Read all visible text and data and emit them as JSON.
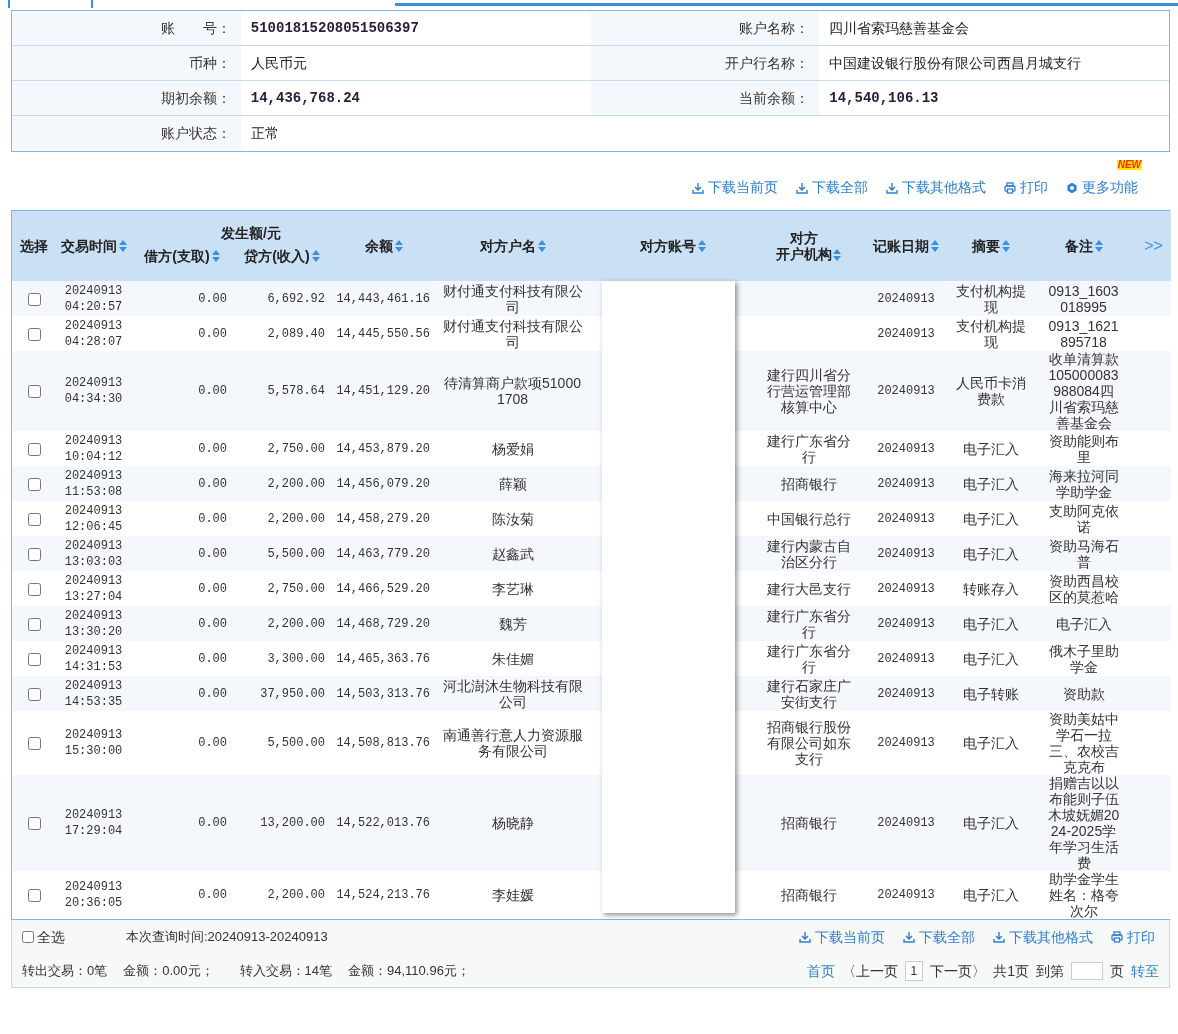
{
  "account_info": [
    {
      "label": "账　　号：",
      "value": "5100181520805150639​7",
      "kind": "amount"
    },
    {
      "label": "账户名称：",
      "value": "四川省索玛慈善基金会",
      "kind": "text"
    },
    {
      "label": "币种：",
      "value": "人民币元",
      "kind": "text"
    },
    {
      "label": "开户行名称：",
      "value": "中国建设银行股份有限公司西昌月城支行",
      "kind": "text"
    },
    {
      "label": "期初余额：",
      "value": "14,436,768.24",
      "kind": "amount"
    },
    {
      "label": "当前余额：",
      "value": "14,540,106.13",
      "kind": "amount"
    },
    {
      "label": "账户状态：",
      "value": "正常",
      "kind": "text"
    }
  ],
  "toolbar": {
    "new_badge": "NEW",
    "links": [
      {
        "kind": "download",
        "label": "下载当前页"
      },
      {
        "kind": "download",
        "label": "下载全部"
      },
      {
        "kind": "download",
        "label": "下载其他格式"
      },
      {
        "kind": "print",
        "label": "打印"
      },
      {
        "kind": "settings",
        "label": "更多功能"
      }
    ]
  },
  "table": {
    "group_header": "发生额/元",
    "more_columns": ">>",
    "columns": [
      {
        "label_lines": [
          "选择"
        ],
        "sortable": false
      },
      {
        "label_lines": [
          "交易时间"
        ],
        "sortable": true
      },
      {
        "label_lines": [
          "借方(支取)"
        ],
        "sortable": true,
        "in_group": true
      },
      {
        "label_lines": [
          "贷方(收入)"
        ],
        "sortable": true,
        "in_group": true
      },
      {
        "label_lines": [
          "余额"
        ],
        "sortable": true
      },
      {
        "label_lines": [
          "对方户名"
        ],
        "sortable": true
      },
      {
        "label_lines": [
          "对方账号"
        ],
        "sortable": true
      },
      {
        "label_lines": [
          "对方",
          "开户机构"
        ],
        "sortable": true
      },
      {
        "label_lines": [
          "记账日期"
        ],
        "sortable": true
      },
      {
        "label_lines": [
          "摘要"
        ],
        "sortable": true
      },
      {
        "label_lines": [
          "备注"
        ],
        "sortable": true
      }
    ],
    "rows": [
      {
        "checked": false,
        "date_part": "20240913",
        "time_part": "04:20:57",
        "debit": "0.00",
        "credit": "6,692.92",
        "balance": "14,443,461.16",
        "name": "财付通支付科技有限公司",
        "bank": "",
        "post_date": "20240913",
        "summary": "支付机构提现",
        "remark": "0913_1603018995"
      },
      {
        "checked": false,
        "date_part": "20240913",
        "time_part": "04:28:07",
        "debit": "0.00",
        "credit": "2,089.40",
        "balance": "14,445,550.56",
        "name": "财付通支付科技有限公司",
        "bank": "",
        "post_date": "20240913",
        "summary": "支付机构提现",
        "remark": "0913_1621895718"
      },
      {
        "checked": false,
        "date_part": "20240913",
        "time_part": "04:34:30",
        "debit": "0.00",
        "credit": "5,578.64",
        "balance": "14,451,129.20",
        "name": "待清算商户款项510001708",
        "bank": "建行四川省分行营运管理部核算中心",
        "post_date": "20240913",
        "summary": "人民币卡消费款",
        "remark": "收单清算款105000083988084四川省索玛慈善基金会"
      },
      {
        "checked": false,
        "date_part": "20240913",
        "time_part": "10:04:12",
        "debit": "0.00",
        "credit": "2,750.00",
        "balance": "14,453,879.20",
        "name": "杨爱娟",
        "bank": "建行广东省分行",
        "post_date": "20240913",
        "summary": "电子汇入",
        "remark": "资助能则布里"
      },
      {
        "checked": false,
        "date_part": "20240913",
        "time_part": "11:53:08",
        "debit": "0.00",
        "credit": "2,200.00",
        "balance": "14,456,079.20",
        "name": "薛颖",
        "bank": "招商银行",
        "post_date": "20240913",
        "summary": "电子汇入",
        "remark": "海来拉河同学助学金"
      },
      {
        "checked": false,
        "date_part": "20240913",
        "time_part": "12:06:45",
        "debit": "0.00",
        "credit": "2,200.00",
        "balance": "14,458,279.20",
        "name": "陈汝菊",
        "bank": "中国银行总行",
        "post_date": "20240913",
        "summary": "电子汇入",
        "remark": "支助阿克依诺"
      },
      {
        "checked": false,
        "date_part": "20240913",
        "time_part": "13:03:03",
        "debit": "0.00",
        "credit": "5,500.00",
        "balance": "14,463,779.20",
        "name": "赵鑫武",
        "bank": "建行内蒙古自治区分行",
        "post_date": "20240913",
        "summary": "电子汇入",
        "remark": "资助马海石普"
      },
      {
        "checked": false,
        "date_part": "20240913",
        "time_part": "13:27:04",
        "debit": "0.00",
        "credit": "2,750.00",
        "balance": "14,466,529.20",
        "name": "李艺琳",
        "bank": "建行大邑支行",
        "post_date": "20240913",
        "summary": "转账存入",
        "remark": "资助西昌校区的莫惹哈"
      },
      {
        "checked": false,
        "date_part": "20240913",
        "time_part": "13:30:20",
        "debit": "0.00",
        "credit": "2,200.00",
        "balance": "14,468,729.20",
        "name": "魏芳",
        "bank": "建行广东省分行",
        "post_date": "20240913",
        "summary": "电子汇入",
        "remark": "电子汇入"
      },
      {
        "checked": false,
        "date_part": "20240913",
        "time_part": "14:31:53",
        "debit": "0.00",
        "credit": "3,300.00",
        "balance": "14,465,363.76",
        "name": "朱佳媚",
        "bank": "建行广东省分行",
        "post_date": "20240913",
        "summary": "电子汇入",
        "remark": "俄木子里助学金"
      },
      {
        "checked": false,
        "date_part": "20240913",
        "time_part": "14:53:35",
        "debit": "0.00",
        "credit": "37,950.00",
        "balance": "14,503,313.76",
        "name": "河北澍沐生物科技有限公司",
        "bank": "建行石家庄广安街支行",
        "post_date": "20240913",
        "summary": "电子转账",
        "remark": "资助款"
      },
      {
        "checked": false,
        "date_part": "20240913",
        "time_part": "15:30:00",
        "debit": "0.00",
        "credit": "5,500.00",
        "balance": "14,508,813.76",
        "name": "南通善行意人力资源服务有限公司",
        "bank": "招商银行股份有限公司如东支行",
        "post_date": "20240913",
        "summary": "电子汇入",
        "remark": "资助美姑中学石一拉三、农校吉克克布"
      },
      {
        "checked": false,
        "date_part": "20240913",
        "time_part": "17:29:04",
        "debit": "0.00",
        "credit": "13,200.00",
        "balance": "14,522,013.76",
        "name": "杨晓静",
        "bank": "招商银行",
        "post_date": "20240913",
        "summary": "电子汇入",
        "remark": "捐赠吉以以布能则子伍木坡妩媚2024-2025学年学习生活费"
      },
      {
        "checked": false,
        "date_part": "20240913",
        "time_part": "20:36:05",
        "debit": "0.00",
        "credit": "2,200.00",
        "balance": "14,524,213.76",
        "name": "李娃媛",
        "bank": "招商银行",
        "post_date": "20240913",
        "summary": "电子汇入",
        "remark": "助学金学生姓名：格夸次尔"
      }
    ]
  },
  "footer": {
    "select_all": {
      "label": "全选",
      "checked": false
    },
    "query_time": "本次查询时间:20240913-20240913",
    "links": [
      {
        "kind": "download",
        "label": "下载当前页"
      },
      {
        "kind": "download",
        "label": "下载全部"
      },
      {
        "kind": "download",
        "label": "下载其他格式"
      },
      {
        "kind": "print",
        "label": "打印"
      }
    ],
    "stats": [
      "转出交易：0笔",
      "金额：0.00元；",
      "转入交易：14笔",
      "金额：94,110.96元；"
    ],
    "pager": {
      "first": "首页",
      "prev": "〈上一页",
      "page": "1",
      "next": "下一页〉",
      "total": "共1页",
      "goto_prefix": "到第",
      "goto_suffix": "页",
      "goto": "转至"
    }
  }
}
